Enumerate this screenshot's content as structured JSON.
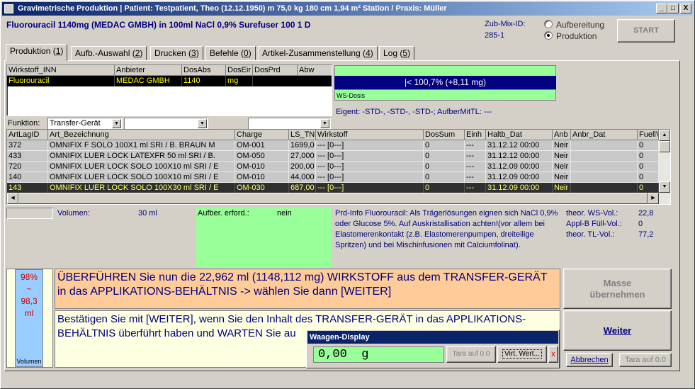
{
  "window": {
    "title": "Gravimetrische Produktion  |  Patient: Testpatient, Theo (12.12.1950) m 75,0 kg  180 cm  1,94 m² Station / Praxis: Müller",
    "title_icon": "app-icon",
    "controls": [
      "_",
      "□",
      "X"
    ]
  },
  "header": {
    "product": "Fluorouracil 1140mg (MEDAC GMBH) in 100ml NaCl 0,9% Surefuser 100 1 D",
    "zub_mix_label": "Zub-Mix-ID:",
    "zub_mix_id": "285-1",
    "radio_aufbereitung": "Aufbereitung",
    "radio_produktion": "Produktion",
    "start_button": "START"
  },
  "tabs": [
    {
      "label": "Produktion",
      "num": "1"
    },
    {
      "label": "Aufb.-Auswahl",
      "num": "2"
    },
    {
      "label": "Drucken",
      "num": "3"
    },
    {
      "label": "Befehle",
      "num": "0"
    },
    {
      "label": "Artikel-Zusammenstellung",
      "num": "4"
    },
    {
      "label": "Log",
      "num": "5"
    }
  ],
  "wirkstoff_table": {
    "headers": [
      "Wirkstoff_INN",
      "Anbieter",
      "DosAbs",
      "DosEir",
      "DosPrd",
      "Abw"
    ],
    "rows": [
      [
        "Fluorouracil",
        "MEDAC GMBH",
        "1140",
        "mg",
        "",
        ""
      ]
    ]
  },
  "dose_bar": {
    "label": "|<  100,7%  (+8,11 mg)",
    "caption": "WS-Dosis",
    "percent": 100.7
  },
  "eigent": "Eigent: -STD-, -STD-, -STD-; AufberMitTL: ---",
  "funktion": {
    "label": "Funktion:",
    "value": "Transfer-Gerät",
    "combo2": "",
    "combo3": ""
  },
  "articles_table": {
    "headers": [
      "ArtLagID",
      "Art_Bezeichnung",
      "Charge",
      "LS_TN",
      "Wirkstoff",
      "DosSum",
      "Einh",
      "Haltb_Dat",
      "Anb",
      "Anbr_Dat",
      "FuellV"
    ],
    "rows": [
      [
        "372",
        "OMNIFIX F SOLO    100X1 ml SRI  / B. BRAUN M",
        "OM-001",
        "1699,0",
        "--- [0---]",
        "0",
        "---",
        "31.12.12 00:00",
        "Neir",
        "",
        "0"
      ],
      [
        "433",
        "OMNIFIX LUER LOCK LATEXFR   50 ml SRI  / B.",
        "OM-050",
        "27,000",
        "--- [0---]",
        "0",
        "---",
        "31.12.12 00:00",
        "Neir",
        "",
        "0"
      ],
      [
        "720",
        "OMNIFIX LUER LOCK SOLO    100X10 ml SRI  / E",
        "OM-010",
        "200,00",
        "--- [0---]",
        "0",
        "---",
        "31.12.09 00:00",
        "Neir",
        "",
        "0"
      ],
      [
        "140",
        "OMNIFIX LUER LOCK SOLO    100X10 ml SRI  / E",
        "OM-010",
        "44,000",
        "--- [0---]",
        "0",
        "---",
        "31.12.09 00:00",
        "Neir",
        "",
        "0"
      ],
      [
        "143",
        "OMNIFIX LUER LOCK SOLO    100X30 ml SRI  / E",
        "OM-030",
        "687,00",
        "--- [0---]",
        "0",
        "---",
        "31.12.09 00:00",
        "Neir",
        "",
        "0"
      ]
    ],
    "selected_row": 4
  },
  "info": {
    "volumen_label": "Volumen:",
    "volumen_value": "30 ml",
    "aufber_label": "Aufber. erford.:",
    "aufber_value": "nein",
    "prd_info": "Prd-Info Fluorouracil: Als Trägerlösungen eignen sich NaCl 0,9% oder Glucose 5%. Auf Auskristallisation achten!(vor allem bei Elastomerenkontakt (z.B. Elastomerenpumpen, dreiteilige Spritzen) und bei Mischinfusionen mit Calciumfolinat).",
    "theor_ws_label": "theor. WS-Vol.:",
    "theor_ws_value": "22,8",
    "applb_label": "Appl-B Füll-Vol.:",
    "applb_value": "0",
    "theor_tl_label": "theor. TL-Vol.:",
    "theor_tl_value": "77,2"
  },
  "volume_gauge": {
    "range": "98% ~ 98,3 ml",
    "caption": "Volumen"
  },
  "instruction": "ÜBERFÜHREN Sie nun die 22,962 ml (1148,112 mg) WIRKSTOFF aus dem TRANSFER-GERÄT in das APPLIKATIONS-BEHÄLTNIS -> wählen Sie dann [WEITER]",
  "confirmation": "Bestätigen Sie mit [WEITER], wenn Sie den Inhalt des TRANSFER-GERÄT in das APPLIKATIONS-BEHÄLTNIS überführt haben und WARTEN Sie au",
  "buttons": {
    "masse": "Masse übernehmen",
    "weiter": "Weiter",
    "abbrechen": "Abbrechen",
    "tara_bottom": "Tara auf 0.0"
  },
  "waagen": {
    "title": "Waagen-Display",
    "value": "0,00  g",
    "tara": "Tara auf 0.0",
    "virt": "Virt. Wert...",
    "close": "x"
  },
  "colors": {
    "title_start": "#0a246a",
    "green": "#99ff99",
    "navy": "#000080",
    "orange": "#ffcc99",
    "yellow": "#ffffe1",
    "blue": "#99ccff",
    "red": "#cc0000"
  }
}
